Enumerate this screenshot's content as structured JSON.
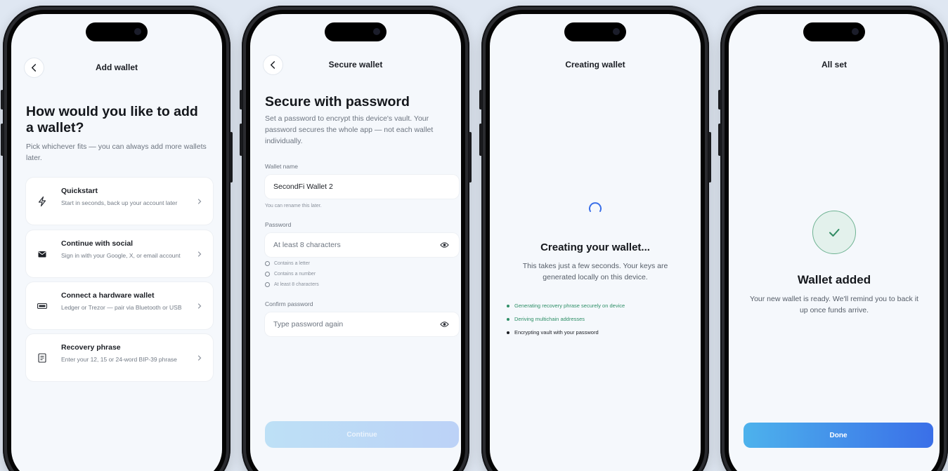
{
  "colors": {
    "background": "#dfe7f2",
    "screen": "#f5f8fc",
    "accent_blue": "#3a6fe8",
    "accent_cyan": "#4db2ec",
    "success_green": "#2f8a61",
    "step_done_green": "#2e8f67",
    "text_primary": "#14171c",
    "text_secondary": "#6d7580"
  },
  "screen1": {
    "nav_title": "Add wallet",
    "heading": "How would you like to add a wallet?",
    "subtitle": "Pick whichever fits — you can always add more wallets later.",
    "options": [
      {
        "icon": "lightning-icon",
        "title": "Quickstart",
        "desc": "Start in seconds, back up your account later"
      },
      {
        "icon": "envelope-icon",
        "title": "Continue with social",
        "desc": "Sign in with your Google, X, or email account"
      },
      {
        "icon": "hardware-wallet-icon",
        "title": "Connect a hardware wallet",
        "desc": "Ledger or Trezor — pair via Bluetooth or USB"
      },
      {
        "icon": "document-icon",
        "title": "Recovery phrase",
        "desc": "Enter your 12, 15 or 24-word BIP-39 phrase"
      }
    ]
  },
  "screen2": {
    "nav_title": "Secure wallet",
    "heading": "Secure with password",
    "subtitle": "Set a password to encrypt this device's vault. Your password secures the whole app — not each wallet individually.",
    "wallet_name_label": "Wallet name",
    "wallet_name_value": "SecondFi Wallet 2",
    "wallet_name_hint": "You can rename this later.",
    "password_label": "Password",
    "password_placeholder": "At least 8 characters",
    "requirements": [
      "Contains a letter",
      "Contains a number",
      "At least 8 characters"
    ],
    "confirm_label": "Confirm password",
    "confirm_placeholder": "Type password again",
    "continue_label": "Continue"
  },
  "screen3": {
    "nav_title": "Creating wallet",
    "heading": "Creating your wallet...",
    "subtitle": "This takes just a few seconds. Your keys are generated locally on this device.",
    "steps": [
      {
        "label": "Generating recovery phrase securely on device",
        "status": "done"
      },
      {
        "label": "Deriving multichain addresses",
        "status": "done"
      },
      {
        "label": "Encrypting vault with your password",
        "status": "active"
      }
    ]
  },
  "screen4": {
    "nav_title": "All set",
    "heading": "Wallet added",
    "subtitle": "Your new wallet is ready. We'll remind you to back it up once funds arrive.",
    "done_label": "Done"
  }
}
